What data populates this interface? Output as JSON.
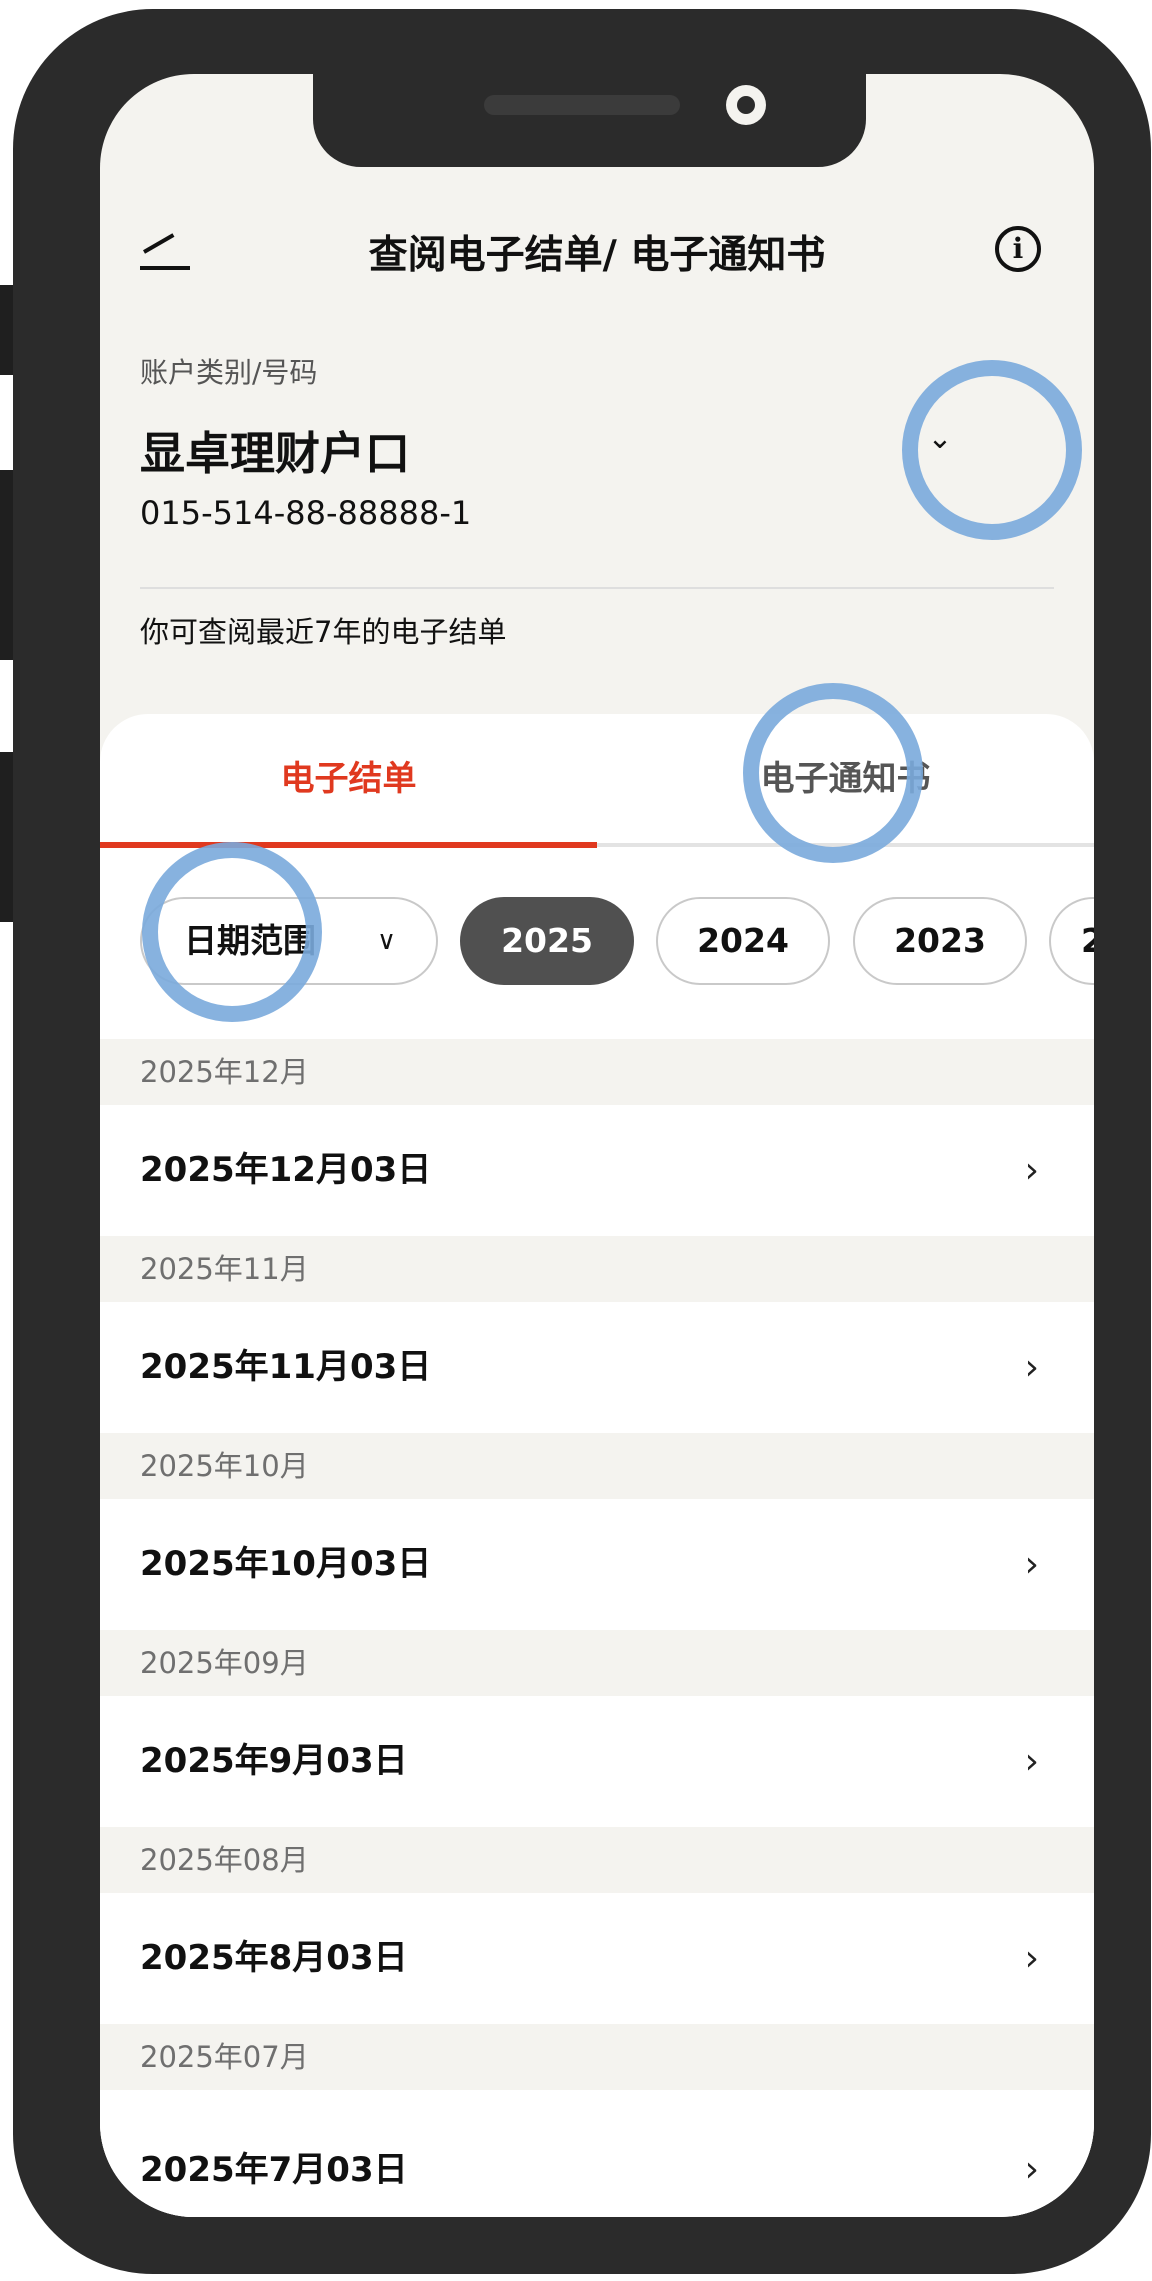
{
  "header": {
    "title": "查阅电子结单/ 电子通知书",
    "info_icon": "info-circle-icon",
    "back_icon": "back-arrow-icon"
  },
  "account": {
    "label": "账户类别/号码",
    "name": "显卓理财户口",
    "number": "015-514-88-88888-1",
    "dropdown_icon": "chevron-down-icon"
  },
  "retention_note": "你可查阅最近7年的电子结单",
  "tabs": [
    {
      "label": "电子结单",
      "active": true
    },
    {
      "label": "电子通知书",
      "active": false
    }
  ],
  "filters": {
    "date_range_label": "日期范围",
    "years": [
      "2025",
      "2024",
      "2023",
      "2"
    ],
    "selected_year": "2025"
  },
  "statements": [
    {
      "month": "2025年12月",
      "date": "2025年12月03日"
    },
    {
      "month": "2025年11月",
      "date": "2025年11月03日"
    },
    {
      "month": "2025年10月",
      "date": "2025年10月03日"
    },
    {
      "month": "2025年09月",
      "date": "2025年9月03日"
    },
    {
      "month": "2025年08月",
      "date": "2025年8月03日"
    },
    {
      "month": "2025年07月",
      "date": "2025年7月03日"
    }
  ],
  "colors": {
    "accent": "#e0391f",
    "chip_selected": "#505050",
    "annotation": "#7aaadc",
    "frame": "#2b2b2b"
  }
}
